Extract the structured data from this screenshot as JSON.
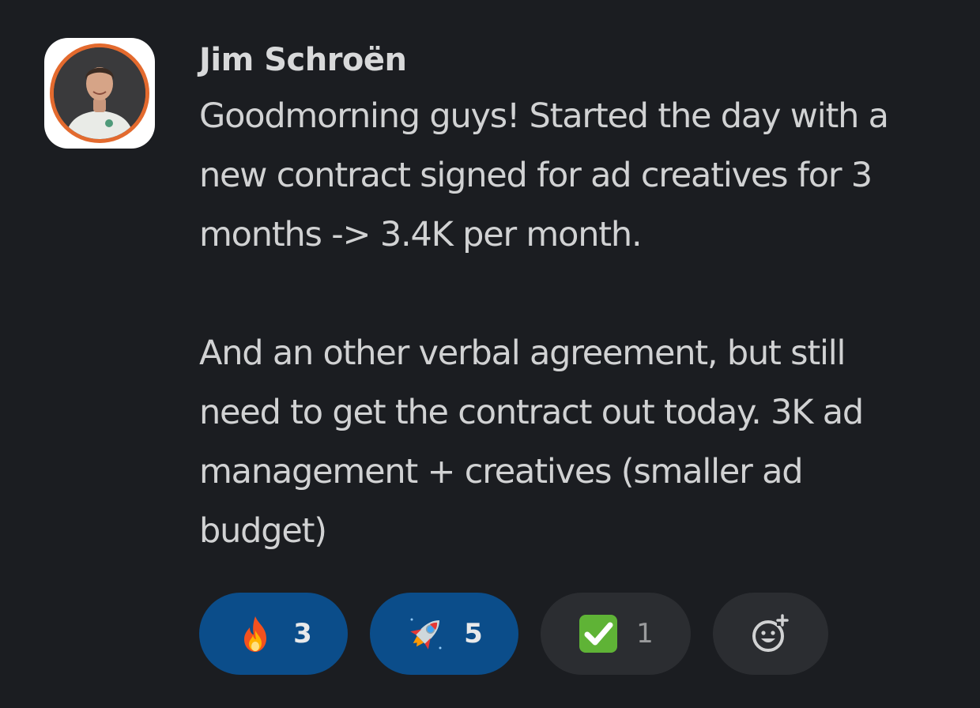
{
  "message": {
    "author": "Jim Schroën",
    "lines": [
      "Goodmorning guys! Started the day with a",
      "new contract signed for ad creatives for 3",
      "months -> 3.4K per month.",
      "",
      "And an other verbal agreement, but still",
      "need to get the contract out today. 3K ad",
      "management + creatives (smaller ad",
      "budget)"
    ]
  },
  "reactions": [
    {
      "emoji": "fire-icon",
      "count": "3",
      "active": true
    },
    {
      "emoji": "rocket-icon",
      "count": "5",
      "active": true
    },
    {
      "emoji": "check-mark-icon",
      "count": "1",
      "active": false
    },
    {
      "emoji": "add-reaction-icon",
      "count": "",
      "active": false
    }
  ],
  "colors": {
    "background": "#1b1d21",
    "active_reaction": "#0b4d8a",
    "inactive_reaction": "#2b2d31",
    "avatar_ring": "#e36a2e",
    "check_green": "#5fb336"
  }
}
